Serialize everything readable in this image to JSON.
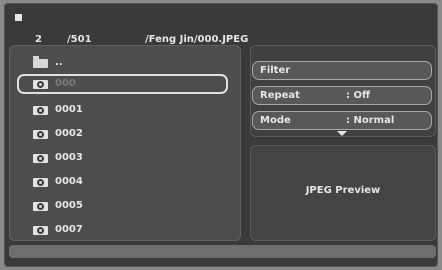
{
  "header": {
    "current_index": "2",
    "total_count": "/501",
    "file_path": "/Feng Jin/000.JPEG"
  },
  "file_list": [
    {
      "label": "..",
      "icon": "folder-icon"
    },
    {
      "label": "000",
      "icon": "photo-icon",
      "selected": true
    },
    {
      "label": "0001",
      "icon": "photo-icon"
    },
    {
      "label": "0002",
      "icon": "photo-icon"
    },
    {
      "label": "0003",
      "icon": "photo-icon"
    },
    {
      "label": "0004",
      "icon": "photo-icon"
    },
    {
      "label": "0005",
      "icon": "photo-icon"
    },
    {
      "label": "0007",
      "icon": "photo-icon"
    }
  ],
  "options": {
    "filter_label": "Filter",
    "repeat_label": "Repeat",
    "repeat_value": ": Off",
    "mode_label": "Mode",
    "mode_value": ": Normal"
  },
  "preview": {
    "label": "JPEG Preview"
  }
}
